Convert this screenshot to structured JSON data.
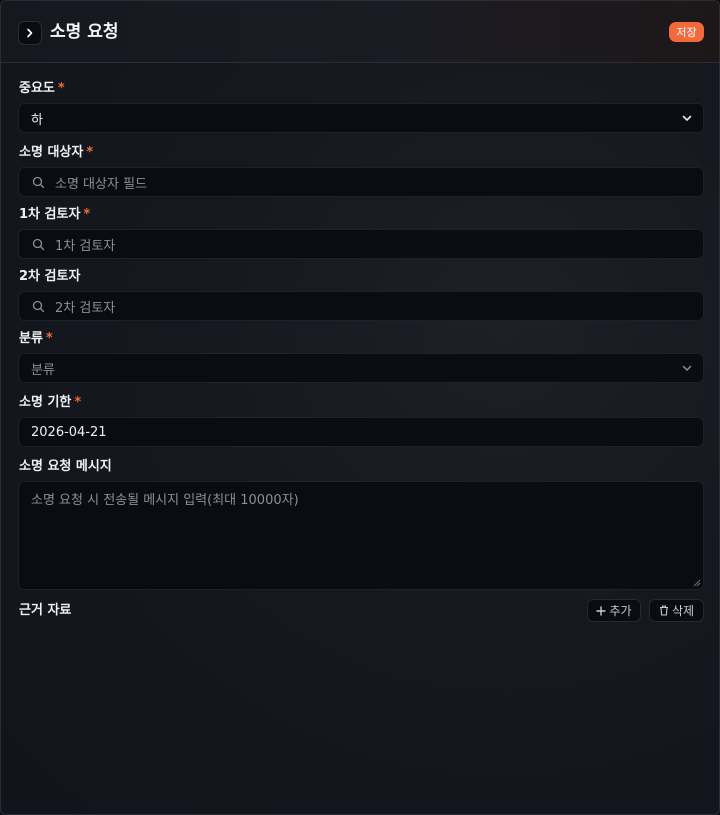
{
  "header": {
    "title": "소명 요청",
    "save_label": "저장"
  },
  "required_mark": "*",
  "form": {
    "importance": {
      "label": "중요도",
      "required": true,
      "value": "하"
    },
    "target": {
      "label": "소명 대상자",
      "required": true,
      "placeholder": "소명 대상자 필드"
    },
    "reviewer1": {
      "label": "1차 검토자",
      "required": true,
      "placeholder": "1차 검토자"
    },
    "reviewer2": {
      "label": "2차 검토자",
      "required": false,
      "placeholder": "2차 검토자"
    },
    "category": {
      "label": "분류",
      "required": true,
      "placeholder": "분류"
    },
    "deadline": {
      "label": "소명 기한",
      "required": true,
      "value": "2026-04-21"
    },
    "message": {
      "label": "소명 요청 메시지",
      "placeholder": "소명 요청 시 전송될 메시지 입력(최대 10000자)"
    },
    "evidence": {
      "label": "근거 자료",
      "add_label": "추가",
      "delete_label": "삭제"
    }
  },
  "colors": {
    "accent": "#f26a3b",
    "background": "#16181f",
    "field": "#0a0c12"
  },
  "icons": [
    "chevron-right-icon",
    "chevron-down-icon",
    "search-icon",
    "plus-icon",
    "trash-icon"
  ]
}
